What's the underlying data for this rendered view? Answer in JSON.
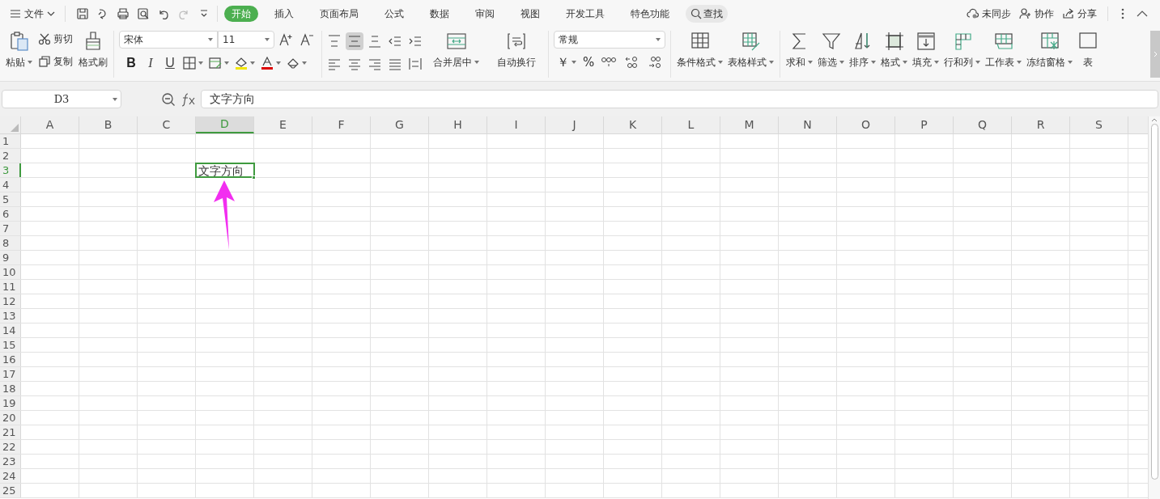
{
  "menu": {
    "label": "文件"
  },
  "tabs": [
    {
      "label": "开始",
      "selected": true
    },
    {
      "label": "插入",
      "selected": false
    },
    {
      "label": "页面布局",
      "selected": false
    },
    {
      "label": "公式",
      "selected": false
    },
    {
      "label": "数据",
      "selected": false
    },
    {
      "label": "审阅",
      "selected": false
    },
    {
      "label": "视图",
      "selected": false
    },
    {
      "label": "开发工具",
      "selected": false
    },
    {
      "label": "特色功能",
      "selected": false
    }
  ],
  "search": {
    "label": "查找"
  },
  "top_actions": [
    "未同步",
    "协作",
    "分享"
  ],
  "clipboard": {
    "paste": "粘贴",
    "cut": "剪切",
    "copy": "复制",
    "format_painter": "格式刷"
  },
  "font": {
    "name": "宋体",
    "size": "11",
    "bold": "B",
    "italic": "I",
    "underline": "U"
  },
  "alignment": {
    "buttons": [
      {
        "label": "合并居中",
        "dropdown": true
      },
      {
        "label": "自动换行",
        "dropdown": false
      }
    ]
  },
  "number": {
    "format": "常规",
    "currency": "￥",
    "percent": "%"
  },
  "ribbon_buttons": [
    {
      "label": "条件格式",
      "dropdown": true
    },
    {
      "label": "表格样式",
      "dropdown": true
    },
    {
      "label": "求和",
      "dropdown": true
    },
    {
      "label": "筛选",
      "dropdown": true
    },
    {
      "label": "排序",
      "dropdown": true
    },
    {
      "label": "格式",
      "dropdown": true
    },
    {
      "label": "填充",
      "dropdown": true
    },
    {
      "label": "行和列",
      "dropdown": true
    },
    {
      "label": "工作表",
      "dropdown": true
    },
    {
      "label": "冻结窗格",
      "dropdown": true
    },
    {
      "label": "表",
      "dropdown": false
    }
  ],
  "formula_bar": {
    "name_box": "D3",
    "formula": "文字方向"
  },
  "grid": {
    "columns": [
      {
        "label": "A",
        "selected": false
      },
      {
        "label": "B",
        "selected": false
      },
      {
        "label": "C",
        "selected": false
      },
      {
        "label": "D",
        "selected": true
      },
      {
        "label": "E",
        "selected": false
      },
      {
        "label": "F",
        "selected": false
      },
      {
        "label": "G",
        "selected": false
      },
      {
        "label": "H",
        "selected": false
      },
      {
        "label": "I",
        "selected": false
      },
      {
        "label": "J",
        "selected": false
      },
      {
        "label": "K",
        "selected": false
      },
      {
        "label": "L",
        "selected": false
      },
      {
        "label": "M",
        "selected": false
      },
      {
        "label": "N",
        "selected": false
      },
      {
        "label": "O",
        "selected": false
      },
      {
        "label": "P",
        "selected": false
      },
      {
        "label": "Q",
        "selected": false
      },
      {
        "label": "R",
        "selected": false
      },
      {
        "label": "S",
        "selected": false
      }
    ],
    "rows": [
      {
        "label": "1",
        "selected": false
      },
      {
        "label": "2",
        "selected": false
      },
      {
        "label": "3",
        "selected": true,
        "cells": [
          null,
          null,
          null,
          "文字方向"
        ]
      },
      {
        "label": "4",
        "selected": false
      },
      {
        "label": "5",
        "selected": false
      },
      {
        "label": "6",
        "selected": false
      },
      {
        "label": "7",
        "selected": false
      },
      {
        "label": "8",
        "selected": false
      },
      {
        "label": "9",
        "selected": false
      },
      {
        "label": "10",
        "selected": false
      },
      {
        "label": "11",
        "selected": false
      },
      {
        "label": "12",
        "selected": false
      },
      {
        "label": "13",
        "selected": false
      },
      {
        "label": "14",
        "selected": false
      },
      {
        "label": "15",
        "selected": false
      },
      {
        "label": "16",
        "selected": false
      },
      {
        "label": "17",
        "selected": false
      },
      {
        "label": "18",
        "selected": false
      },
      {
        "label": "19",
        "selected": false
      },
      {
        "label": "20",
        "selected": false
      },
      {
        "label": "21",
        "selected": false
      },
      {
        "label": "22",
        "selected": false
      },
      {
        "label": "23",
        "selected": false
      },
      {
        "label": "24",
        "selected": false
      },
      {
        "label": "25",
        "selected": false
      }
    ]
  }
}
